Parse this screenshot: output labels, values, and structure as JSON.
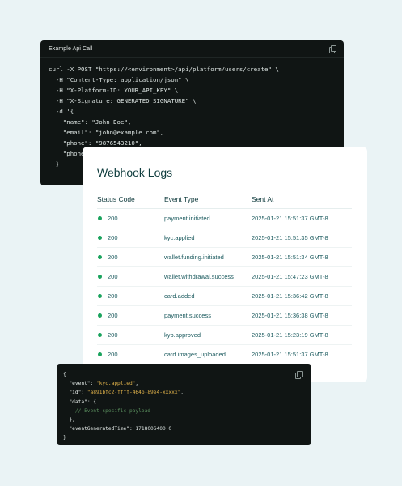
{
  "api_card": {
    "title": "Example Api Call",
    "code": "curl -X POST \"https://<environment>/api/platform/users/create\" \\\n  -H \"Content-Type: application/json\" \\\n  -H \"X-Platform-ID: YOUR_API_KEY\" \\\n  -H \"X-Signature: GENERATED_SIGNATURE\" \\\n  -d '{\n    \"name\": \"John Doe\",\n    \"email\": \"john@example.com\",\n    \"phone\": \"9876543210\",\n    \"phone\n  }'"
  },
  "webhook_logs": {
    "title": "Webhook Logs",
    "columns": [
      "Status Code",
      "Event Type",
      "Sent At"
    ],
    "status_color": "#1aa35d",
    "rows": [
      {
        "status": "200",
        "event": "payment.initiated",
        "sent_at": "2025-01-21 15:51:37 GMT-8"
      },
      {
        "status": "200",
        "event": "kyc.applied",
        "sent_at": "2025-01-21 15:51:35 GMT-8"
      },
      {
        "status": "200",
        "event": "wallet.funding.initiated",
        "sent_at": "2025-01-21 15:51:34 GMT-8"
      },
      {
        "status": "200",
        "event": "wallet.withdrawal.success",
        "sent_at": "2025-01-21 15:47:23 GMT-8"
      },
      {
        "status": "200",
        "event": "card.added",
        "sent_at": "2025-01-21 15:36:42 GMT-8"
      },
      {
        "status": "200",
        "event": "payment.success",
        "sent_at": "2025-01-21 15:36:38 GMT-8"
      },
      {
        "status": "200",
        "event": "kyb.approved",
        "sent_at": "2025-01-21 15:23:19 GMT-8"
      },
      {
        "status": "200",
        "event": "card.images_uploaded",
        "sent_at": "2025-01-21 15:51:37 GMT-8"
      }
    ]
  },
  "payload_card": {
    "open_brace": "{",
    "event_key": "\"event\"",
    "event_val": "\"kyc.applied\"",
    "id_key": "\"id\"",
    "id_val": "\"a891bfc2-ffff-464b-89e4-xxxxx\"",
    "data_key": "\"data\"",
    "data_open": ": {",
    "comment": "// Event-specific payload",
    "data_close": "},",
    "time_key": "\"eventGeneratedTime\"",
    "time_val": "1718006400.0",
    "close_brace": "}",
    "colors": {
      "string": "#e0b24a",
      "comment": "#5a8f5e",
      "background": "#101514"
    }
  },
  "icons": [
    "copy-icon"
  ]
}
